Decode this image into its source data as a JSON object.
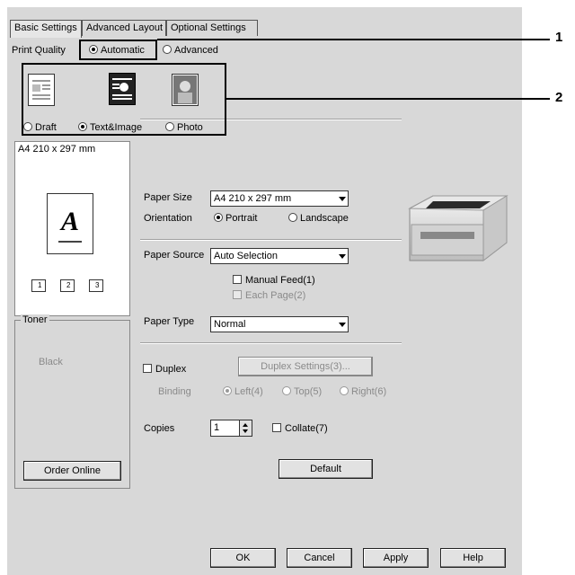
{
  "tabs": [
    {
      "label": "Basic Settings",
      "active": true
    },
    {
      "label": "Advanced Layout",
      "active": false
    },
    {
      "label": "Optional Settings",
      "active": false
    }
  ],
  "print_quality": {
    "label": "Print Quality",
    "automatic": "Automatic",
    "advanced": "Advanced",
    "selected": "Automatic"
  },
  "quality_modes": {
    "draft": "Draft",
    "text_image": "Text&Image",
    "photo": "Photo",
    "selected": "Text&Image"
  },
  "preview": {
    "paper_label": "A4 210 x 297 mm",
    "glyph": "A",
    "copy_nums": [
      "1",
      "2",
      "3"
    ]
  },
  "toner": {
    "title": "Toner",
    "color": "Black",
    "order_button": "Order Online"
  },
  "paper_size": {
    "label": "Paper Size",
    "value": "A4 210 x 297 mm"
  },
  "orientation": {
    "label": "Orientation",
    "portrait": "Portrait",
    "landscape": "Landscape",
    "selected": "Portrait"
  },
  "paper_source": {
    "label": "Paper Source",
    "value": "Auto Selection",
    "manual_feed": "Manual Feed(1)",
    "each_page": "Each Page(2)"
  },
  "paper_type": {
    "label": "Paper Type",
    "value": "Normal"
  },
  "duplex": {
    "label": "Duplex",
    "settings_button": "Duplex Settings(3)...",
    "binding_label": "Binding",
    "left": "Left(4)",
    "top": "Top(5)",
    "right": "Right(6)"
  },
  "copies": {
    "label": "Copies",
    "value": "1",
    "collate": "Collate(7)"
  },
  "default_button": "Default",
  "footer": {
    "ok": "OK",
    "cancel": "Cancel",
    "apply": "Apply",
    "help": "Help"
  },
  "callouts": [
    "1",
    "2"
  ]
}
